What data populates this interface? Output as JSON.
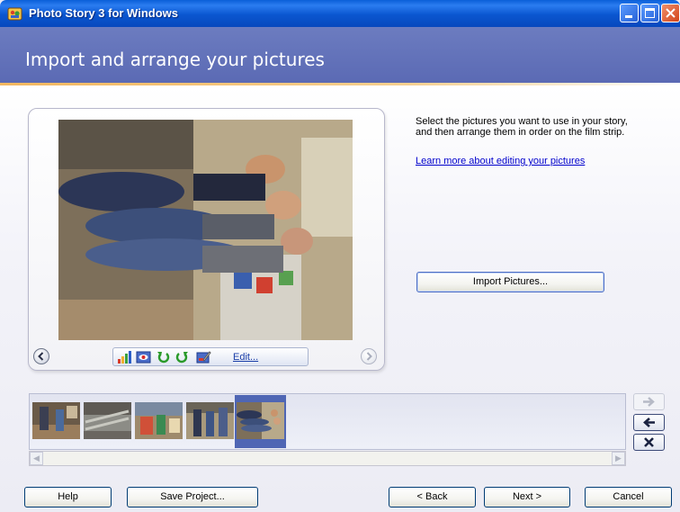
{
  "window": {
    "title": "Photo Story 3 for Windows"
  },
  "header": {
    "title": "Import and arrange your pictures"
  },
  "instructions": {
    "text": "Select the pictures you want to use in your story,\nand then arrange them in order on the film strip.",
    "learn_more_link": "Learn more about editing your pictures"
  },
  "buttons": {
    "import": "Import Pictures...",
    "help": "Help",
    "save_project": "Save Project...",
    "back": "< Back",
    "next": "Next >",
    "cancel": "Cancel"
  },
  "toolbar": {
    "edit_label": "Edit...",
    "icons": [
      "auto-correct-icon",
      "red-eye-icon",
      "rotate-left-icon",
      "rotate-right-icon",
      "edit-icon"
    ]
  },
  "filmstrip": {
    "thumbnail_count": 5,
    "selected_index": 4
  },
  "colors": {
    "titlebar": "#0a56d0",
    "header": "#5b6ab4",
    "accent_line": "#f4b860",
    "selection": "#4f66b4"
  }
}
